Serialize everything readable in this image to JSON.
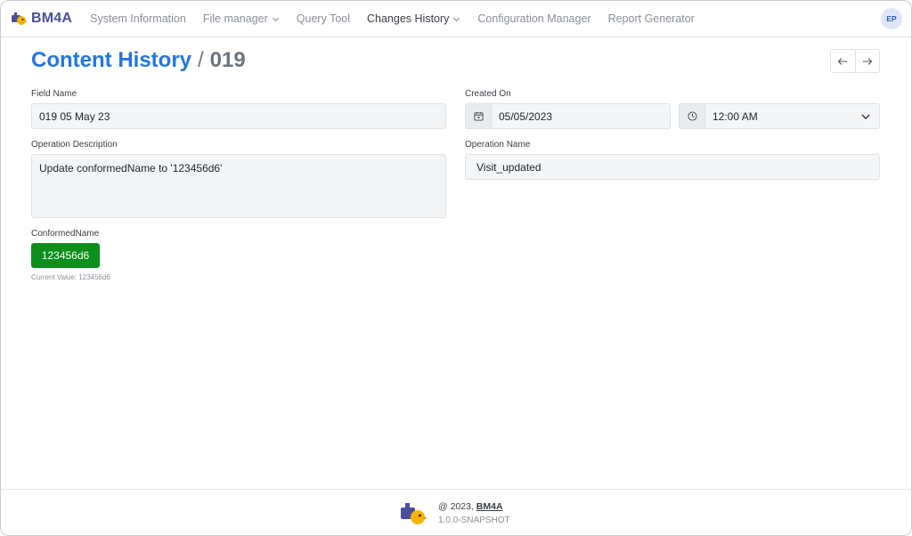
{
  "app": {
    "brand": "BM4A",
    "avatar_initials": "EP",
    "accent_color": "#2376e2",
    "brand_color": "#4a4f9a"
  },
  "nav": {
    "items": [
      {
        "label": "System Information",
        "dropdown": false
      },
      {
        "label": "File manager",
        "dropdown": true
      },
      {
        "label": "Query Tool",
        "dropdown": false
      },
      {
        "label": "Changes History",
        "dropdown": true,
        "active": true
      },
      {
        "label": "Configuration Manager",
        "dropdown": false
      },
      {
        "label": "Report Generator",
        "dropdown": false
      }
    ]
  },
  "page": {
    "title": "Content History",
    "separator": "/",
    "record_id": "019"
  },
  "form": {
    "field_name": {
      "label": "Field Name",
      "value": "019 05 May 23"
    },
    "created_on": {
      "label": "Created On",
      "date": "05/05/2023",
      "time": "12:00 AM"
    },
    "operation_description": {
      "label": "Operation Description",
      "value": "Update conformedName to '123456d6'"
    },
    "operation_name": {
      "label": "Operation Name",
      "value": "Visit_updated"
    },
    "conformed_name": {
      "label": "ConformedName",
      "button": "123456d6",
      "current_value": "Current Value: 123456d6",
      "button_color": "#0a8f1a"
    }
  },
  "footer": {
    "copyright_prefix": "@ 2023,",
    "brand": "BM4A",
    "version": "1.0.0-SNAPSHOT"
  }
}
